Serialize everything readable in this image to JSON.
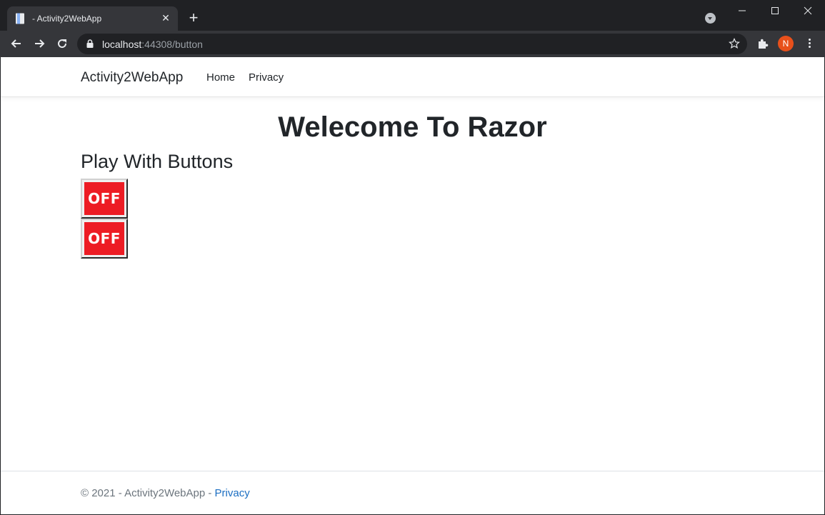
{
  "browser": {
    "tab_title": "- Activity2WebApp",
    "tab_close": "✕",
    "new_tab": "+",
    "url_host": "localhost",
    "url_rest": ":44308/button",
    "avatar_letter": "N"
  },
  "navbar": {
    "brand": "Activity2WebApp",
    "links": [
      "Home",
      "Privacy"
    ]
  },
  "main": {
    "heading": "Welecome To Razor",
    "subheading": "Play With Buttons",
    "buttons": [
      {
        "label": "OFF",
        "color": "#ed1c24"
      },
      {
        "label": "OFF",
        "color": "#ed1c24"
      }
    ]
  },
  "footer": {
    "text": "© 2021 - Activity2WebApp - ",
    "link": "Privacy",
    "link_color": "#1b6ec2"
  }
}
